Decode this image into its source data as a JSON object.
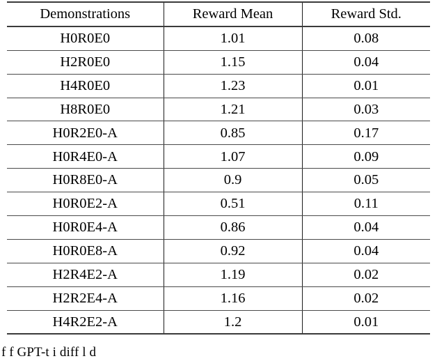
{
  "table": {
    "columns": [
      "Demonstrations",
      "Reward Mean",
      "Reward Std."
    ],
    "rows": [
      {
        "demonstrations": "H0R0E0",
        "reward_mean": "1.01",
        "reward_std": "0.08"
      },
      {
        "demonstrations": "H2R0E0",
        "reward_mean": "1.15",
        "reward_std": "0.04"
      },
      {
        "demonstrations": "H4R0E0",
        "reward_mean": "1.23",
        "reward_std": "0.01"
      },
      {
        "demonstrations": "H8R0E0",
        "reward_mean": "1.21",
        "reward_std": "0.03"
      },
      {
        "demonstrations": "H0R2E0-A",
        "reward_mean": "0.85",
        "reward_std": "0.17"
      },
      {
        "demonstrations": "H0R4E0-A",
        "reward_mean": "1.07",
        "reward_std": "0.09"
      },
      {
        "demonstrations": "H0R8E0-A",
        "reward_mean": "0.9",
        "reward_std": "0.05"
      },
      {
        "demonstrations": "H0R0E2-A",
        "reward_mean": "0.51",
        "reward_std": "0.11"
      },
      {
        "demonstrations": "H0R0E4-A",
        "reward_mean": "0.86",
        "reward_std": "0.04"
      },
      {
        "demonstrations": "H0R0E8-A",
        "reward_mean": "0.92",
        "reward_std": "0.04"
      },
      {
        "demonstrations": "H2R4E2-A",
        "reward_mean": "1.19",
        "reward_std": "0.02"
      },
      {
        "demonstrations": "H2R2E4-A",
        "reward_mean": "1.16",
        "reward_std": "0.02"
      },
      {
        "demonstrations": "H4R2E2-A",
        "reward_mean": "1.2",
        "reward_std": "0.01"
      }
    ]
  },
  "caption": {
    "text": "f                            f GPT-t      i    diff                    l     d"
  }
}
